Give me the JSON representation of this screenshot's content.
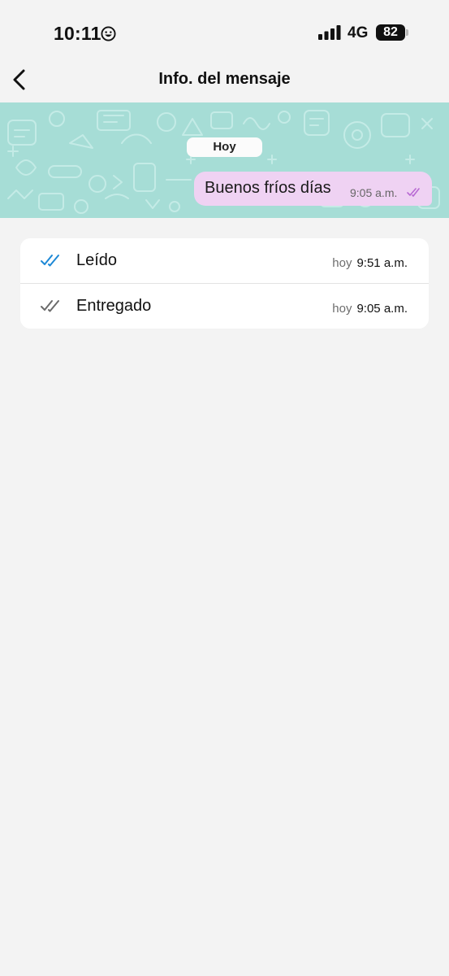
{
  "status_bar": {
    "time": "10:11",
    "network": "4G",
    "battery": "82",
    "icons": [
      "smiley-icon",
      "signal-bars-icon",
      "battery-icon"
    ]
  },
  "header": {
    "title": "Info. del mensaje",
    "back_icon": "chevron-left-icon"
  },
  "chat_preview": {
    "date_chip": "Hoy",
    "message": {
      "text": "Buenos fríos días",
      "time": "9:05 a.m.",
      "status_icon": "double-check-icon",
      "bubble_color": "#efd2f3",
      "tick_color": "#b86ad3"
    },
    "wallpaper_color": "#a6ddd6"
  },
  "receipts": [
    {
      "label": "Leído",
      "day": "hoy",
      "time": "9:51 a.m.",
      "icon": "double-check-read-icon",
      "icon_color": "#1d88d6"
    },
    {
      "label": "Entregado",
      "day": "hoy",
      "time": "9:05 a.m.",
      "icon": "double-check-delivered-icon",
      "icon_color": "#6b6b6b"
    }
  ]
}
